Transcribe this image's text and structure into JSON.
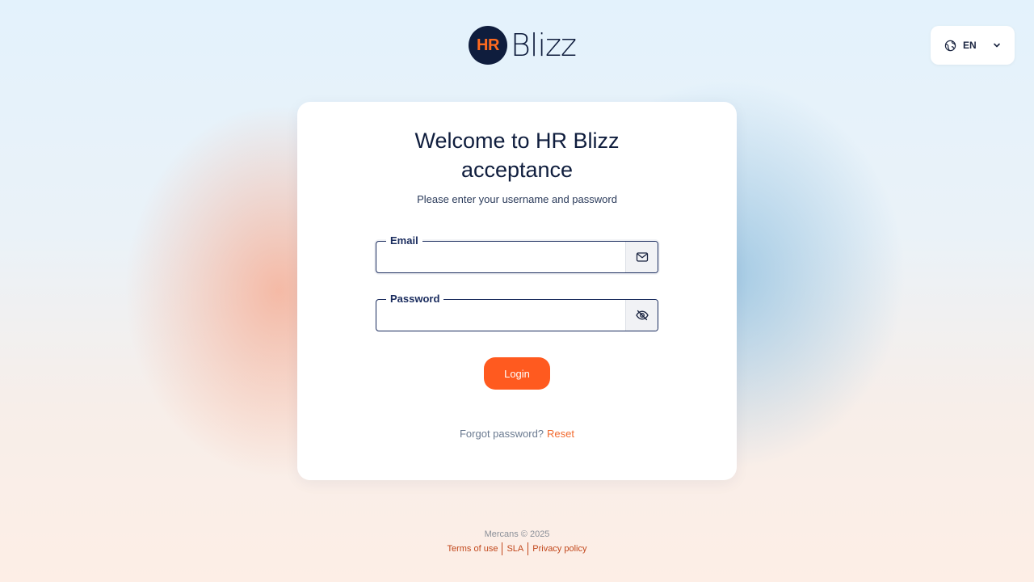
{
  "logo": {
    "badge": "HR",
    "text": "Blizz"
  },
  "language": {
    "code": "EN",
    "icon": "globe-icon",
    "dropdown_icon": "chevron-down-icon"
  },
  "card": {
    "title_line1": "Welcome to HR Blizz",
    "title_line2": "acceptance",
    "subtitle": "Please enter your username and password"
  },
  "form": {
    "email": {
      "label": "Email",
      "value": "",
      "icon": "mail-icon"
    },
    "password": {
      "label": "Password",
      "value": "",
      "icon": "eye-off-icon"
    },
    "login_label": "Login",
    "forgot_text": "Forgot password?",
    "reset_label": "Reset"
  },
  "footer": {
    "copyright": "Mercans © 2025",
    "links": [
      "Terms of use",
      "SLA",
      "Privacy policy"
    ]
  },
  "colors": {
    "accent": "#ff5a1f",
    "navy": "#0f1d3d",
    "link": "#c2481c"
  }
}
